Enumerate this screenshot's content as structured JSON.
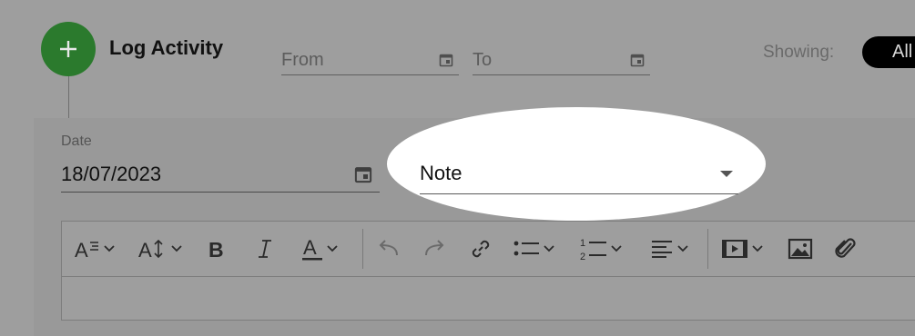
{
  "header": {
    "title": "Log Activity",
    "add_icon": "plus-icon",
    "from_placeholder": "From",
    "to_placeholder": "To",
    "showing_label": "Showing:",
    "showing_value": "All",
    "calendar_icon": "calendar-icon"
  },
  "form": {
    "date_label": "Date",
    "date_value": "18/07/2023",
    "type_value": "Note"
  },
  "toolbar": {
    "tools": [
      "paragraph-format-icon",
      "font-size-icon",
      "bold-icon",
      "italic-icon",
      "text-color-icon",
      "undo-icon",
      "redo-icon",
      "link-icon",
      "bulleted-list-icon",
      "numbered-list-icon",
      "align-icon",
      "insert-video-icon",
      "insert-image-icon",
      "attach-file-icon"
    ]
  },
  "colors": {
    "accent_green": "#2b7a2d",
    "overlay_grey": "#9e9e9e",
    "highlight": "#ffffff"
  }
}
